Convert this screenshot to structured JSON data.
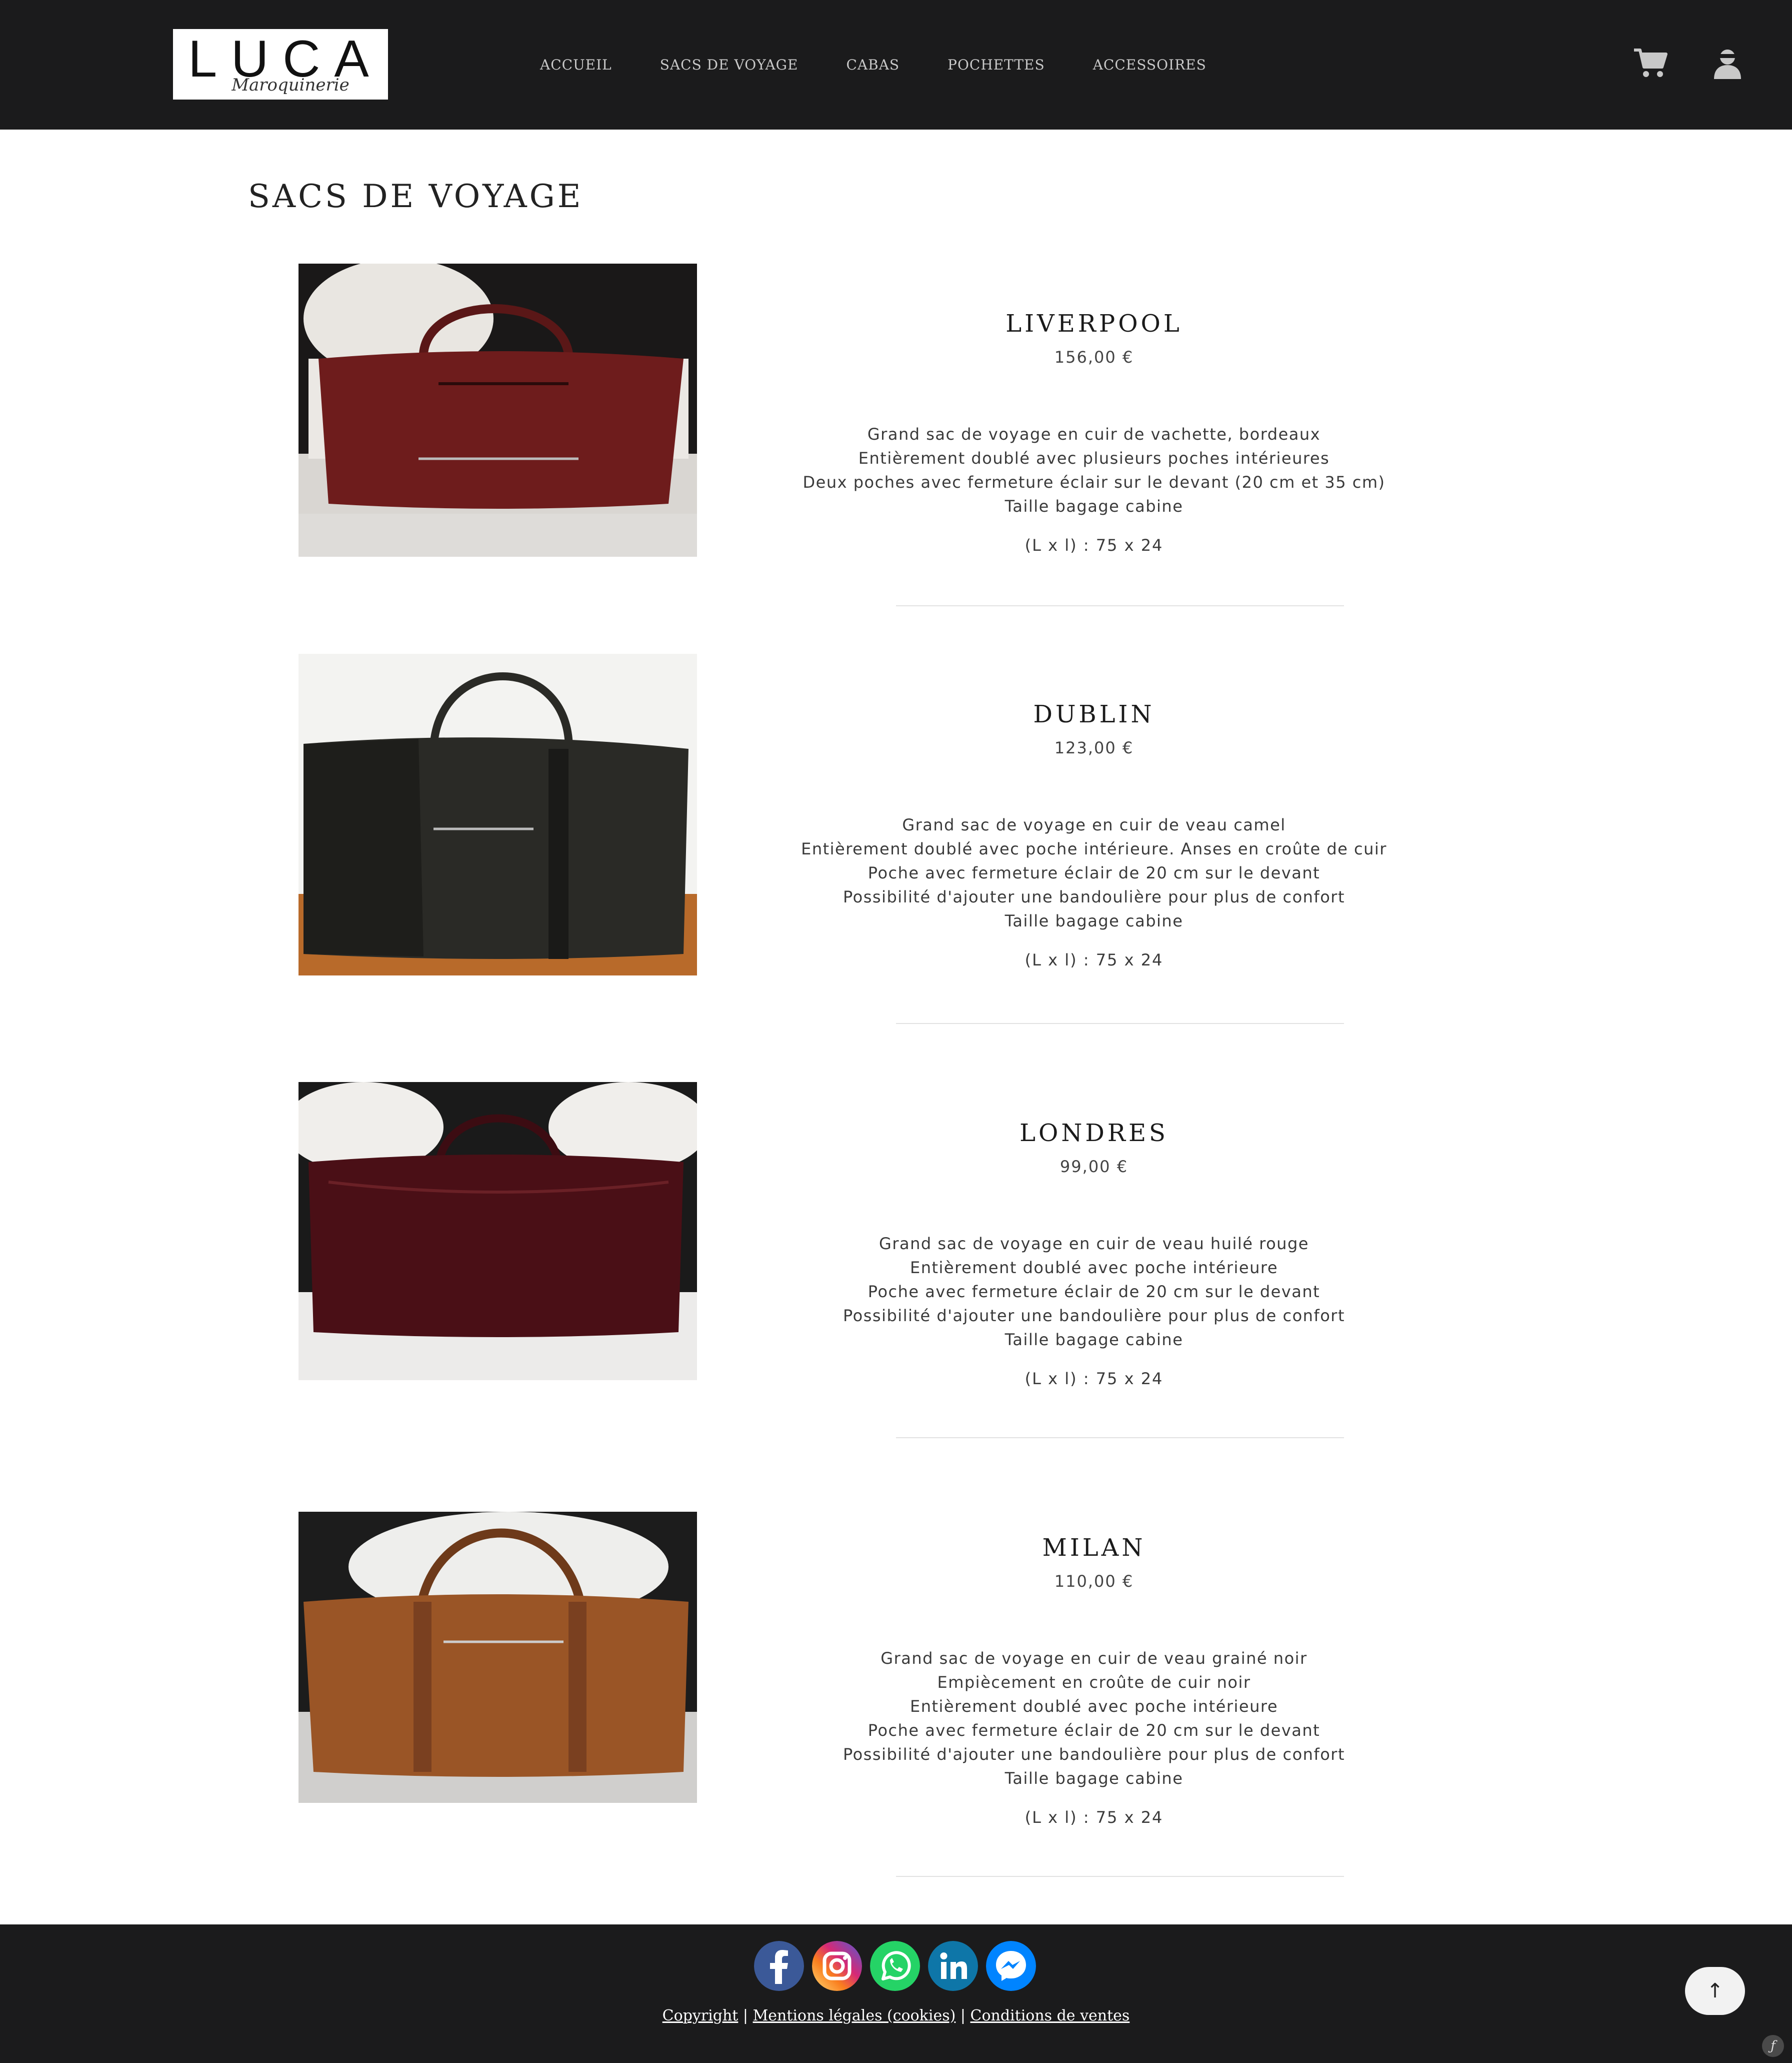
{
  "header": {
    "logo": {
      "word": "LUCA",
      "subtitle": "Maroquinerie"
    },
    "nav": [
      "ACCUEIL",
      "SACS DE VOYAGE",
      "CABAS",
      "POCHETTES",
      "ACCESSOIRES"
    ],
    "icons": [
      "cart-icon",
      "user-icon"
    ]
  },
  "page": {
    "title": "SACS DE VOYAGE"
  },
  "products": [
    {
      "name": "LIVERPOOL",
      "price": "156,00 €",
      "description": [
        "Grand sac de voyage en cuir de vachette, bordeaux",
        "Entièrement doublé avec plusieurs poches intérieures",
        "Deux poches avec fermeture éclair sur le devant (20 cm et 35 cm)",
        "Taille bagage cabine"
      ],
      "dimensions": "(L x l) : 75 x 24",
      "bag_color": "#6e1c1c"
    },
    {
      "name": "DUBLIN",
      "price": "123,00 €",
      "description": [
        "Grand sac de voyage en cuir de veau camel",
        "Entièrement doublé avec poche intérieure. Anses en croûte de cuir",
        "Poche avec fermeture éclair de 20 cm sur le devant",
        "Possibilité d'ajouter une bandoulière pour plus de confort",
        "Taille bagage cabine"
      ],
      "dimensions": "(L x l) : 75 x 24",
      "bag_color": "#2a2a26"
    },
    {
      "name": "LONDRES",
      "price": "99,00 €",
      "description": [
        "Grand sac de voyage en cuir de veau huilé rouge",
        "Entièrement doublé avec poche intérieure",
        "Poche avec fermeture éclair de 20 cm sur le devant",
        "Possibilité d'ajouter une bandoulière pour plus de confort",
        "Taille bagage cabine"
      ],
      "dimensions": "(L x l) : 75 x 24",
      "bag_color": "#4a0f16"
    },
    {
      "name": "MILAN",
      "price": "110,00 €",
      "description": [
        "Grand sac de voyage en cuir de veau grainé noir",
        "Empiècement en croûte de cuir noir",
        "Entièrement doublé avec poche intérieure",
        "Poche avec fermeture éclair de 20 cm sur le devant",
        "Possibilité d'ajouter une bandoulière pour plus de confort",
        "Taille bagage cabine"
      ],
      "dimensions": "(L x l) : 75 x 24",
      "bag_color": "#9a5526"
    }
  ],
  "footer": {
    "socials": [
      "facebook-icon",
      "instagram-icon",
      "whatsapp-icon",
      "linkedin-icon",
      "messenger-icon"
    ],
    "links": [
      "Copyright",
      "Mentions légales (cookies)",
      "Conditions de ventes"
    ],
    "separator": "|",
    "to_top": "↑",
    "badge": "ƒ"
  },
  "colors": {
    "header_bg": "#1b1b1c",
    "nav_text": "#c9c9c9",
    "footer_bg": "#1b1b1c"
  }
}
